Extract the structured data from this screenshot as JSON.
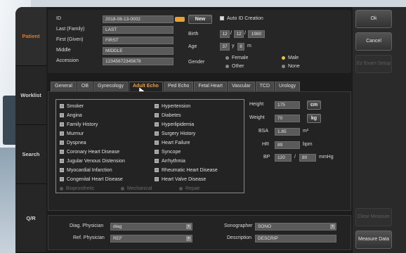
{
  "nav": {
    "patient": "Patient",
    "worklist": "Worklist",
    "search": "Search",
    "qr": "Q/R"
  },
  "patient": {
    "id_label": "ID",
    "id_value": "2018-08-13-0002",
    "new_label": "New",
    "auto_id_label": "Auto ID Creation",
    "last_label": "Last (Family)",
    "last_value": "LAST",
    "first_label": "First (Given)",
    "first_value": "FIRST",
    "middle_label": "Middle",
    "middle_value": "MIDDLE",
    "accession_label": "Accession",
    "accession_value": "12345672345678",
    "birth_label": "Birth",
    "birth_mm": "12",
    "birth_dd": "12",
    "birth_yyyy": "1980",
    "age_label": "Age",
    "age_years": "37",
    "age_y_unit": "y",
    "age_months": "8",
    "age_m_unit": "m",
    "gender_label": "Gender",
    "gender_options": [
      "Female",
      "Male",
      "Other",
      "None"
    ],
    "gender_selected": "Male"
  },
  "tabs": [
    "General",
    "OB",
    "Gynecology",
    "Adult Echo",
    "Ped Echo",
    "Fetal Heart",
    "Vascular",
    "TCD",
    "Urology"
  ],
  "active_tab": "Adult Echo",
  "history_left": [
    "Smoker",
    "Angina",
    "Family History",
    "Murmur",
    "Dyspnea",
    "Coronary Heart Disease",
    "Jugular Venous Distension",
    "Myocardial Infarction",
    "Congenital Heart Disease"
  ],
  "history_right": [
    "Hypertension",
    "Diabetes",
    "Hyperlipidemia",
    "Surgery History",
    "Heart Failure",
    "Syncope",
    "Arrhythmia",
    "Rheumatic Heart Disease",
    "Heart Valve Disease"
  ],
  "valve_options": [
    "Bioprosthetic",
    "Mechanical",
    "Repair"
  ],
  "vitals": {
    "height_label": "Height",
    "height_value": "175",
    "height_unit": "cm",
    "weight_label": "Weight",
    "weight_value": "70",
    "weight_unit": "kg",
    "bsa_label": "BSA",
    "bsa_value": "1.85",
    "bsa_unit": "m²",
    "hr_label": "HR",
    "hr_value": "89",
    "hr_unit": "bpm",
    "bp_label": "BP",
    "bp_sys": "120",
    "bp_sep": "/",
    "bp_dia": "80",
    "bp_unit": "mmHg"
  },
  "staff": {
    "diag_label": "Diag. Physician",
    "diag_value": "diag",
    "ref_label": "Ref. Physician",
    "ref_value": "REF",
    "sono_label": "Sonographer",
    "sono_value": "SONO",
    "desc_label": "Description",
    "desc_value": "DESCRIP"
  },
  "right_buttons": {
    "ok": "Ok",
    "cancel": "Cancel",
    "ez_exam": "Ez Exam Setup",
    "clear": "Clear Measure",
    "measure_data": "Measure Data"
  },
  "colors": {
    "accent_orange": "#e07a2c",
    "tab_active": "#e9a049",
    "radio_selected": "#e4c447"
  }
}
